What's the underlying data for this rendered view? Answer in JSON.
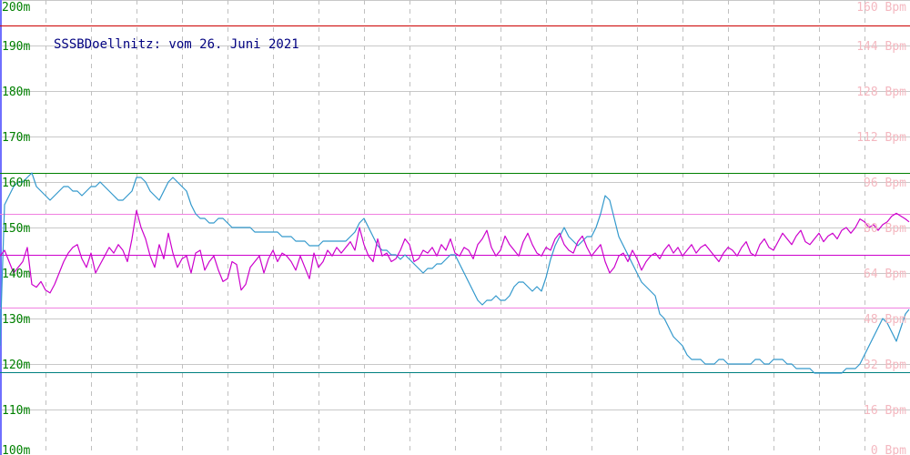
{
  "chart_data": {
    "type": "line",
    "title": "SSSBDoellnitz: vom 26. Juni 2021",
    "left_axis": {
      "ylim": [
        100,
        200
      ],
      "ticks": [
        200,
        190,
        180,
        170,
        160,
        150,
        140,
        130,
        120,
        110,
        100
      ],
      "tick_labels": [
        "200m",
        "190m",
        "180m",
        "170m",
        "160m",
        "150m",
        "140m",
        "130m",
        "120m",
        "110m",
        "100m"
      ]
    },
    "right_axis": {
      "ylim": [
        0,
        160
      ],
      "ticks": [
        160,
        144,
        128,
        112,
        96,
        80,
        64,
        48,
        32,
        16,
        0
      ],
      "tick_labels": [
        "160 Bpm",
        "144 Bpm",
        "128 Bpm",
        "112 Bpm",
        "96 Bpm",
        "80 Bpm",
        "64 Bpm",
        "48 Bpm",
        "32 Bpm",
        "16 Bpm",
        "0 Bpm"
      ]
    },
    "x_grid_count": 20,
    "reference_lines": [
      {
        "axis": "left",
        "value": 194.4,
        "color": "#cc0000"
      },
      {
        "axis": "left",
        "value": 162.0,
        "color": "#008000"
      },
      {
        "axis": "left",
        "value": 118.2,
        "color": "#008080"
      },
      {
        "axis": "right",
        "value": 84.8,
        "color": "#f080e0"
      },
      {
        "axis": "right",
        "value": 52.0,
        "color": "#f080e0"
      },
      {
        "axis": "right",
        "value": 70.5,
        "color": "#cc00cc"
      }
    ],
    "series": [
      {
        "axis": "left",
        "color": "#3399cc",
        "x": [
          0,
          5,
          10,
          15,
          20,
          25,
          30,
          35,
          40,
          45,
          50,
          55,
          60,
          65,
          70,
          75,
          80,
          85,
          90,
          95,
          100,
          105,
          110,
          115,
          120,
          125,
          130,
          135,
          140,
          145,
          150,
          155,
          160,
          165,
          170,
          175,
          180,
          185,
          190,
          195,
          200,
          205,
          210,
          215,
          220,
          225,
          230,
          235,
          240,
          245,
          250,
          255,
          260,
          265,
          270,
          275,
          280,
          285,
          290,
          295,
          300,
          305,
          310,
          315,
          320,
          325,
          330,
          335,
          340,
          345,
          350,
          355,
          360,
          365,
          370,
          375,
          380,
          385,
          390,
          395,
          400,
          405,
          410,
          415,
          420,
          425,
          430,
          435,
          440,
          445,
          450,
          455,
          460,
          465,
          470,
          475,
          480,
          485,
          490,
          495,
          500,
          505,
          510,
          515,
          520,
          525,
          530,
          535,
          540,
          545,
          550,
          555,
          560,
          565,
          570,
          575,
          580,
          585,
          590,
          595,
          600,
          605,
          610,
          615,
          620,
          625,
          630,
          635,
          640,
          645,
          650,
          655,
          660,
          665,
          670,
          675,
          680,
          685,
          690,
          695,
          700,
          705,
          710,
          715,
          720,
          725,
          730,
          735,
          740,
          745,
          750,
          755,
          760,
          765,
          770,
          775,
          780,
          785,
          790,
          795,
          800,
          805,
          810,
          815,
          820,
          825,
          830,
          835,
          840,
          845,
          850,
          855,
          860,
          865,
          870,
          875,
          880,
          885,
          890,
          895,
          900,
          905,
          910,
          915,
          920,
          925,
          930,
          935,
          940,
          945,
          950,
          955,
          960,
          965,
          970,
          975,
          980,
          985,
          990,
          995,
          999
        ],
        "y": [
          124,
          155,
          157,
          159,
          160,
          160,
          161,
          162,
          159,
          158,
          157,
          156,
          157,
          158,
          159,
          159,
          158,
          158,
          157,
          158,
          159,
          159,
          160,
          159,
          158,
          157,
          156,
          156,
          157,
          158,
          161,
          161,
          160,
          158,
          157,
          156,
          158,
          160,
          161,
          160,
          159,
          158,
          155,
          153,
          152,
          152,
          151,
          151,
          152,
          152,
          151,
          150,
          150,
          150,
          150,
          150,
          149,
          149,
          149,
          149,
          149,
          149,
          148,
          148,
          148,
          147,
          147,
          147,
          146,
          146,
          146,
          147,
          147,
          147,
          147,
          147,
          147,
          148,
          149,
          151,
          152,
          150,
          148,
          146,
          145,
          145,
          144,
          144,
          143,
          144,
          143,
          142,
          141,
          140,
          141,
          141,
          142,
          142,
          143,
          144,
          144,
          142,
          140,
          138,
          136,
          134,
          133,
          134,
          134,
          135,
          134,
          134,
          135,
          137,
          138,
          138,
          137,
          136,
          137,
          136,
          139,
          143,
          146,
          148,
          150,
          148,
          147,
          146,
          147,
          148,
          148,
          150,
          153,
          157,
          156,
          152,
          148,
          146,
          144,
          142,
          140,
          138,
          137,
          136,
          135,
          131,
          130,
          128,
          126,
          125,
          124,
          122,
          121,
          121,
          121,
          120,
          120,
          120,
          121,
          121,
          120,
          120,
          120,
          120,
          120,
          120,
          121,
          121,
          120,
          120,
          121,
          121,
          121,
          120,
          120,
          119,
          119,
          119,
          119,
          118,
          118,
          118,
          118,
          118,
          118,
          118,
          119,
          119,
          119,
          120,
          122,
          124,
          126,
          128,
          130,
          129,
          127,
          125,
          128,
          131,
          132
        ],
        "dash": false
      },
      {
        "axis": "right",
        "color": "#cc00cc",
        "x": [
          0,
          5,
          10,
          15,
          20,
          25,
          30,
          35,
          40,
          45,
          50,
          55,
          60,
          65,
          70,
          75,
          80,
          85,
          90,
          95,
          100,
          105,
          110,
          115,
          120,
          125,
          130,
          135,
          140,
          145,
          150,
          155,
          160,
          165,
          170,
          175,
          180,
          185,
          190,
          195,
          200,
          205,
          210,
          215,
          220,
          225,
          230,
          235,
          240,
          245,
          250,
          255,
          260,
          265,
          270,
          275,
          280,
          285,
          290,
          295,
          300,
          305,
          310,
          315,
          320,
          325,
          330,
          335,
          340,
          345,
          350,
          355,
          360,
          365,
          370,
          375,
          380,
          385,
          390,
          395,
          400,
          405,
          410,
          415,
          420,
          425,
          430,
          435,
          440,
          445,
          450,
          455,
          460,
          465,
          470,
          475,
          480,
          485,
          490,
          495,
          500,
          505,
          510,
          515,
          520,
          525,
          530,
          535,
          540,
          545,
          550,
          555,
          560,
          565,
          570,
          575,
          580,
          585,
          590,
          595,
          600,
          605,
          610,
          615,
          620,
          625,
          630,
          635,
          640,
          645,
          650,
          655,
          660,
          665,
          670,
          675,
          680,
          685,
          690,
          695,
          700,
          705,
          710,
          715,
          720,
          725,
          730,
          735,
          740,
          745,
          750,
          755,
          760,
          765,
          770,
          775,
          780,
          785,
          790,
          795,
          800,
          805,
          810,
          815,
          820,
          825,
          830,
          835,
          840,
          845,
          850,
          855,
          860,
          865,
          870,
          875,
          880,
          885,
          890,
          895,
          900,
          905,
          910,
          915,
          920,
          925,
          930,
          935,
          940,
          945,
          950,
          955,
          960,
          965,
          970,
          975,
          980,
          985,
          990,
          995,
          999
        ],
        "y": [
          70,
          72,
          68,
          64,
          66,
          68,
          73,
          60,
          59,
          61,
          58,
          57,
          60,
          64,
          68,
          71,
          73,
          74,
          69,
          66,
          71,
          64,
          67,
          70,
          73,
          71,
          74,
          72,
          68,
          76,
          86,
          80,
          76,
          70,
          66,
          74,
          69,
          78,
          71,
          66,
          69,
          70,
          64,
          71,
          72,
          65,
          68,
          70,
          65,
          61,
          62,
          68,
          67,
          58,
          60,
          66,
          68,
          70,
          64,
          69,
          72,
          68,
          71,
          70,
          68,
          65,
          70,
          66,
          62,
          71,
          66,
          68,
          72,
          70,
          73,
          71,
          73,
          75,
          72,
          80,
          74,
          70,
          68,
          76,
          70,
          71,
          68,
          69,
          72,
          76,
          74,
          68,
          69,
          72,
          71,
          73,
          70,
          74,
          72,
          76,
          71,
          70,
          73,
          72,
          69,
          74,
          76,
          79,
          73,
          70,
          72,
          77,
          74,
          72,
          70,
          75,
          78,
          74,
          71,
          70,
          73,
          72,
          76,
          78,
          74,
          72,
          71,
          75,
          77,
          73,
          70,
          72,
          74,
          68,
          64,
          66,
          70,
          71,
          68,
          72,
          69,
          65,
          68,
          70,
          71,
          69,
          72,
          74,
          71,
          73,
          70,
          72,
          74,
          71,
          73,
          74,
          72,
          70,
          68,
          71,
          73,
          72,
          70,
          73,
          75,
          71,
          70,
          74,
          76,
          73,
          72,
          75,
          78,
          76,
          74,
          77,
          79,
          75,
          74,
          76,
          78,
          75,
          77,
          78,
          76,
          79,
          80,
          78,
          80,
          83,
          82,
          80,
          81,
          79,
          81,
          82,
          84,
          85,
          84,
          83,
          82
        ]
      }
    ]
  }
}
